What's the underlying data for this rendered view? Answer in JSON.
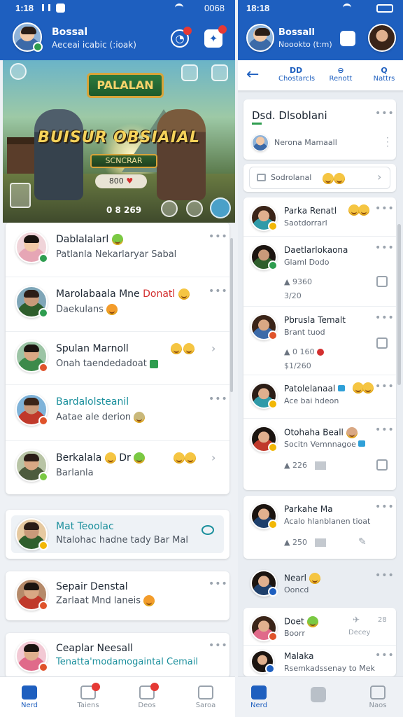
{
  "status_left": {
    "time": "1:18",
    "right": "0068"
  },
  "status_right": {
    "time": "18:18"
  },
  "left_header": {
    "name": "Bossal",
    "subtitle": "Aeceai icabic (:ioak)"
  },
  "banner": {
    "logo": "PALALAN",
    "headline": "BUISUR OBSIAIAL",
    "cta": "SCNCRAR",
    "score": "800",
    "count": "0 8 269"
  },
  "left_chats": [
    {
      "title": "Dablalalarl",
      "message": "Patlanla Nekarlaryar Sabal",
      "badge": "#2e9d4f",
      "hair": "#1b1410",
      "emoji_title": true,
      "emoji_msg": false
    },
    {
      "title": "Marolabaala Mne",
      "title_accent": "Donatl",
      "message": "Daekulans",
      "badge": "#2e9d4f",
      "hair": "#2b1d16",
      "emoji_title": true,
      "emoji_msg": true
    },
    {
      "title": "Spulan Marnoll",
      "message": "Onah taendedadoat",
      "badge": "#e0532b",
      "hair": "#1b1410",
      "emoji_title": true,
      "emoji_msg": false
    },
    {
      "title": "Bardalolsteanil",
      "message": "Aatae ale derion",
      "badge": "#e0532b",
      "hair": "#3a2418",
      "emoji_title": false,
      "emoji_msg": true
    },
    {
      "title": "Berkalala",
      "title_tail": "Dr",
      "message": "Barlanla",
      "badge": "#7ac943",
      "hair": "#2b1d16",
      "emoji_title": true,
      "emoji_msg": false
    }
  ],
  "left_featured": {
    "title": "Mat Teoolac",
    "message": "Ntalohac hadne tady Bar Mal"
  },
  "left_chat_6": {
    "title": "Sepair Denstal",
    "message": "Zarlaat Mnd laneis"
  },
  "left_chat_7": {
    "title": "Ceaplar Neesall",
    "message": "Tenatta'modamogaintal Cemail"
  },
  "left_nav": [
    {
      "label": "Nerd",
      "active": true
    },
    {
      "label": "Taiens",
      "active": false
    },
    {
      "label": "Deos",
      "active": false
    },
    {
      "label": "Saroa",
      "active": false
    }
  ],
  "right_header": {
    "name": "Bossall",
    "subtitle": "Noookto (t:m)"
  },
  "right_tabs": [
    {
      "icon": "DD",
      "label": "Chostarcls"
    },
    {
      "icon": "⊖",
      "label": "Renott"
    },
    {
      "icon": "Q",
      "label": "Nattrs"
    }
  ],
  "right_top": {
    "title": "Dsd. Dlsoblani",
    "member": "Nerona Mamaall",
    "search": "Sodrolanal"
  },
  "right_chats": [
    {
      "title": "Parka Renatl",
      "message": "Saotdorrarl",
      "badge": "#f2b705",
      "hair": "#2b1d16"
    },
    {
      "title": "Daetlarlokaona",
      "message": "Glaml Dodo",
      "meta": "9360",
      "meta2": "3/20",
      "badge": "#2e9d4f",
      "hair": "#1b1410"
    },
    {
      "title": "Pbrusla Temalt",
      "message": "Brant tuod",
      "meta": "0 160",
      "meta2": "$1/260",
      "badge": "#e0532b",
      "hair": "#3a2418"
    },
    {
      "title": "Patolelanaal",
      "message": "Ace bai hdeon",
      "badge": "#f2b705",
      "hair": "#2b1d16"
    },
    {
      "title": "Otohaha Beall",
      "message": "Socitn Vemnnagoe",
      "meta": "226",
      "badge": "#f2b705",
      "hair": "#1b1410"
    },
    {
      "title": "Parkahe Ma",
      "message": "Acalo hlanblanen tioat",
      "meta": "250",
      "badge": "#f2b705",
      "hair": "#1b1410"
    },
    {
      "title": "Nearl",
      "message": "Ooncd",
      "badge": "#1e5fbf",
      "hair": "#1b1410"
    },
    {
      "title": "Doet",
      "message": "Boorr",
      "side_label": "Decey",
      "side_num": "28",
      "badge": "#e0532b",
      "hair": "#3a2418"
    },
    {
      "title": "Malaka",
      "message": "Rsemkadssenay to Mek",
      "badge": "#1e5fbf",
      "hair": "#1b1410"
    }
  ],
  "right_nav": [
    {
      "label": "Nerd"
    },
    {
      "label": ""
    },
    {
      "label": "Naos"
    }
  ]
}
